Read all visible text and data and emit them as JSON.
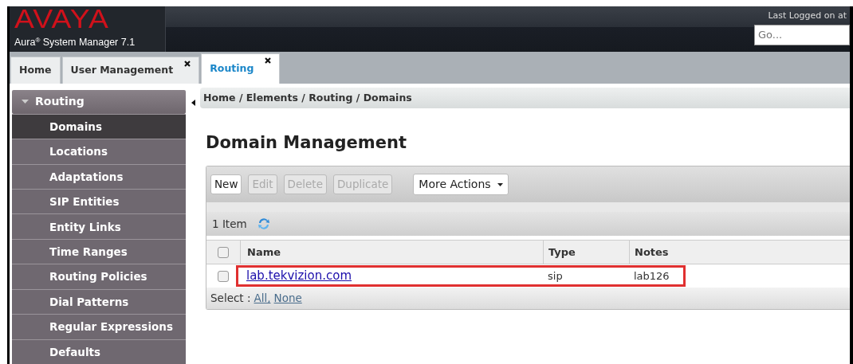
{
  "header": {
    "logo": "AVAYA",
    "product": "Aura$^{®}$ System Manager 7.1",
    "last_logged": "Last Logged on at",
    "search": {
      "placeholder": "Go..."
    }
  },
  "tabs": [
    {
      "label": "Home",
      "closable": false,
      "selected": false
    },
    {
      "label": "User Management",
      "closable": true,
      "selected": false
    },
    {
      "label": "Routing",
      "closable": true,
      "selected": true
    }
  ],
  "sidebar": {
    "title": "Routing",
    "expanded": true,
    "items": [
      {
        "label": "Domains",
        "selected": true
      },
      {
        "label": "Locations",
        "selected": false
      },
      {
        "label": "Adaptations",
        "selected": false
      },
      {
        "label": "SIP Entities",
        "selected": false
      },
      {
        "label": "Entity Links",
        "selected": false
      },
      {
        "label": "Time Ranges",
        "selected": false
      },
      {
        "label": "Routing Policies",
        "selected": false
      },
      {
        "label": "Dial Patterns",
        "selected": false
      },
      {
        "label": "Regular Expressions",
        "selected": false
      },
      {
        "label": "Defaults",
        "selected": false
      }
    ]
  },
  "breadcrumb": "Home / Elements / Routing / Domains",
  "title": "Domain Management",
  "toolbar": {
    "buttons": [
      {
        "label": "New",
        "disabled": false
      },
      {
        "label": "Edit",
        "disabled": true
      },
      {
        "label": "Delete",
        "disabled": true
      },
      {
        "label": "Duplicate",
        "disabled": true
      }
    ],
    "more_actions": "More Actions"
  },
  "count": "1 Item",
  "table": {
    "columns": [
      "Name",
      "Type",
      "Notes"
    ],
    "header_checked": false,
    "rows": [
      {
        "checked": false,
        "highlighted": true,
        "cells": [
          "lab.tekvizion.com",
          "sip",
          "lab126"
        ]
      }
    ]
  },
  "select": {
    "label": "Select :",
    "links": [
      "All,",
      "None"
    ]
  }
}
